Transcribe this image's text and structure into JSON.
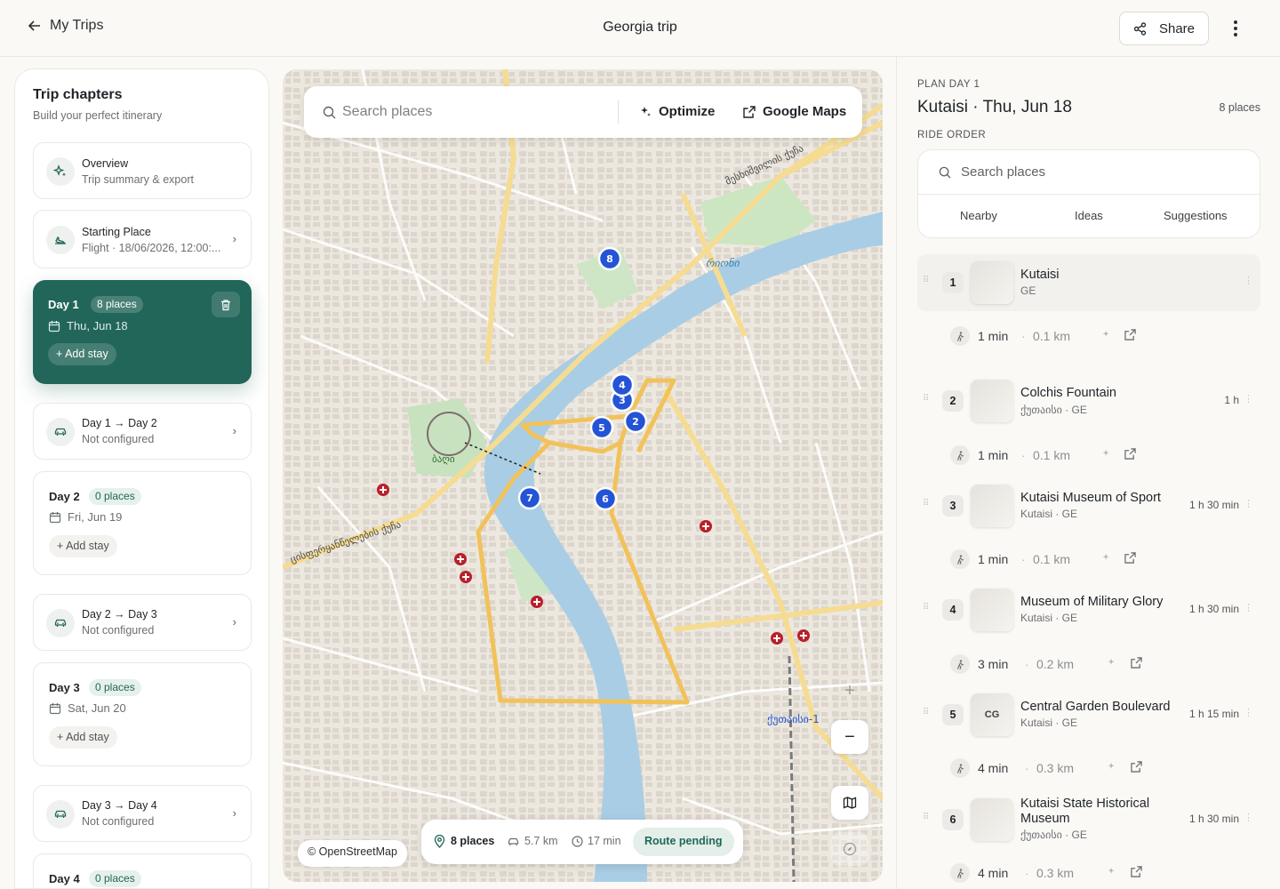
{
  "header": {
    "back_label": "My Trips",
    "title": "Georgia trip",
    "share_label": "Share"
  },
  "sidebar": {
    "title": "Trip chapters",
    "subtitle": "Build your perfect itinerary",
    "overview": {
      "title": "Overview",
      "sub": "Trip summary & export"
    },
    "starting": {
      "title": "Starting Place",
      "sub": "Flight · 18/06/2026, 12:00:..."
    },
    "day1": {
      "label": "Day 1",
      "badge": "8 places",
      "date": "Thu, Jun 18",
      "add": "Add stay"
    },
    "t12": {
      "title": "Day 1 → Day 2",
      "sub": "Not configured"
    },
    "day2": {
      "label": "Day 2",
      "badge": "0 places",
      "date": "Fri, Jun 19",
      "add": "Add stay"
    },
    "t23": {
      "title": "Day 2 → Day 3",
      "sub": "Not configured"
    },
    "day3": {
      "label": "Day 3",
      "badge": "0 places",
      "date": "Sat, Jun 20",
      "add": "Add stay"
    },
    "t34": {
      "title": "Day 3 → Day 4",
      "sub": "Not configured"
    },
    "day4": {
      "label": "Day 4",
      "badge": "0 places"
    }
  },
  "map": {
    "search_placeholder": "Search places",
    "optimize_label": "Optimize",
    "google_label": "Google Maps",
    "attribution": "© OpenStreetMap",
    "stats": {
      "places": "8 places",
      "distance": "5.7 km",
      "time": "17 min",
      "status": "Route pending"
    },
    "zoom_in": "+",
    "zoom_out": "−",
    "markers": [
      "8",
      "4",
      "3",
      "2",
      "5",
      "7",
      "6"
    ],
    "labels": {
      "river": "რიონი",
      "park": "ბაღი",
      "station": "ქუთაისი-1",
      "street_sw": "ცისფერყანწელების ქუჩა",
      "street_ne": "მესხიშვილის ქუჩა"
    }
  },
  "plan": {
    "kicker": "PLAN DAY 1",
    "title": "Kutaisi · Thu, Jun 18",
    "count": "8 places",
    "ride_order": "RIDE ORDER",
    "search_placeholder": "Search places",
    "tabs": [
      "Nearby",
      "Ideas",
      "Suggestions"
    ],
    "stops": [
      {
        "num": "1",
        "name": "Kutaisi",
        "sub": "GE",
        "dur": "",
        "thumb": ""
      },
      {
        "num": "2",
        "name": "Colchis Fountain",
        "sub": "ქუთაისი · GE",
        "dur": "1 h",
        "thumb": ""
      },
      {
        "num": "3",
        "name": "Kutaisi Museum of Sport",
        "sub": "Kutaisi · GE",
        "dur": "1 h 30 min",
        "thumb": ""
      },
      {
        "num": "4",
        "name": "Museum of Military Glory",
        "sub": "Kutaisi · GE",
        "dur": "1 h 30 min",
        "thumb": ""
      },
      {
        "num": "5",
        "name": "Central Garden Boulevard",
        "sub": "Kutaisi · GE",
        "dur": "1 h 15 min",
        "thumb": "CG"
      },
      {
        "num": "6",
        "name": "Kutaisi State Historical Museum",
        "sub": "ქუთაისი · GE",
        "dur": "1 h 30 min",
        "thumb": ""
      }
    ],
    "segments": [
      {
        "time": "1 min",
        "dist": "0.1 km"
      },
      {
        "time": "1 min",
        "dist": "0.1 km"
      },
      {
        "time": "1 min",
        "dist": "0.1 km"
      },
      {
        "time": "3 min",
        "dist": "0.2 km"
      },
      {
        "time": "4 min",
        "dist": "0.3 km"
      },
      {
        "time": "4 min",
        "dist": "0.3 km"
      }
    ]
  },
  "colors": {
    "accent": "#226659",
    "marker": "#2453d6",
    "route": "#f2c25a",
    "river": "#a9cde4",
    "pin": "#b8202a"
  }
}
